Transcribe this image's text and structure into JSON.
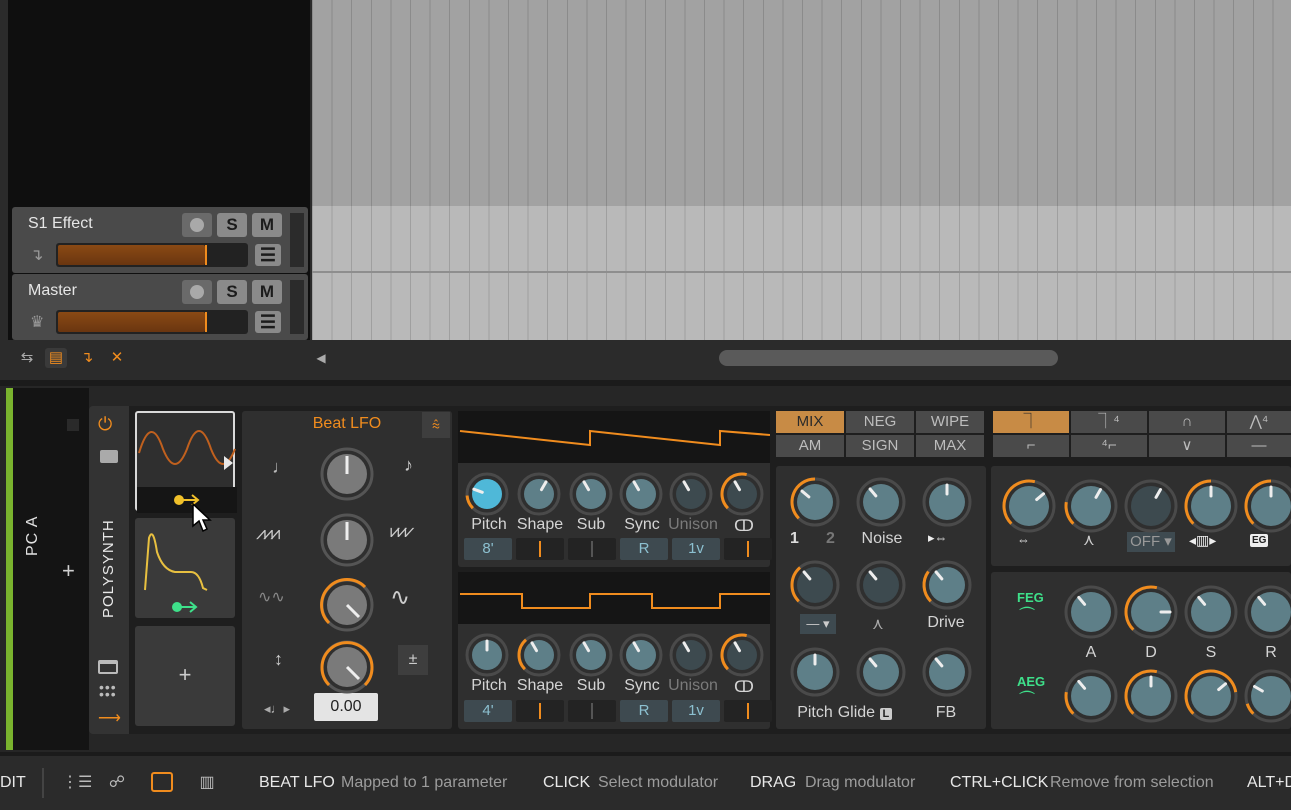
{
  "tracks": [
    {
      "name": "S1 Effect",
      "rec": "",
      "solo": "S",
      "mute": "M",
      "volume_fraction": 0.78,
      "menu": "☰",
      "icon": "↴"
    },
    {
      "name": "Master",
      "rec": "",
      "solo": "S",
      "mute": "M",
      "volume_fraction": 0.78,
      "menu": "☰",
      "icon": "♛"
    }
  ],
  "arranger_tools": [
    "⇆",
    "▤",
    "↴",
    "✕"
  ],
  "scroll_left": "◀",
  "chain": {
    "name": "PC A",
    "add": "+"
  },
  "device": {
    "name": "POLYSYNTH",
    "add_modulator": "+"
  },
  "lfo": {
    "title": "Beat LFO",
    "value": "0.00",
    "bipolar": "±"
  },
  "osc1": {
    "labels": [
      "Pitch",
      "Shape",
      "Sub",
      "Sync",
      "Unison",
      "ↀ"
    ],
    "values": [
      "8'",
      "",
      "",
      "R",
      "1v",
      ""
    ]
  },
  "osc2": {
    "labels": [
      "Pitch",
      "Shape",
      "Sub",
      "Sync",
      "Unison",
      "ↀ"
    ],
    "values": [
      "4'",
      "",
      "",
      "R",
      "1v",
      ""
    ]
  },
  "mix_modes": [
    "MIX",
    "NEG",
    "WIPE",
    "AM",
    "SIGN",
    "MAX"
  ],
  "mixer": {
    "osc1": "1",
    "osc2": "2",
    "noise": "Noise",
    "drive": "Drive",
    "pitch": "Pitch",
    "glide": "Glide",
    "glide_badge": "L",
    "fb": "FB",
    "dropdown": "—"
  },
  "filter": {
    "off_label": "OFF",
    "eg_badge": "EG"
  },
  "envelopes": {
    "feg": "FEG",
    "aeg": "AEG",
    "labels": [
      "A",
      "D",
      "S",
      "R"
    ]
  },
  "status": [
    {
      "key": "DIT",
      "desc": ""
    },
    {
      "key": "BEAT LFO",
      "desc": "Mapped to 1 parameter"
    },
    {
      "key": "CLICK",
      "desc": "Select modulator"
    },
    {
      "key": "DRAG",
      "desc": "Drag modulator"
    },
    {
      "key": "CTRL+CLICK",
      "desc": "Remove from selection"
    },
    {
      "key": "ALT+D",
      "desc": ""
    }
  ],
  "colors": {
    "accent": "#f08c1e",
    "knob_teal": "#5e7f88",
    "mod_green": "#3ee08a",
    "chain_green": "#7ab32e"
  }
}
